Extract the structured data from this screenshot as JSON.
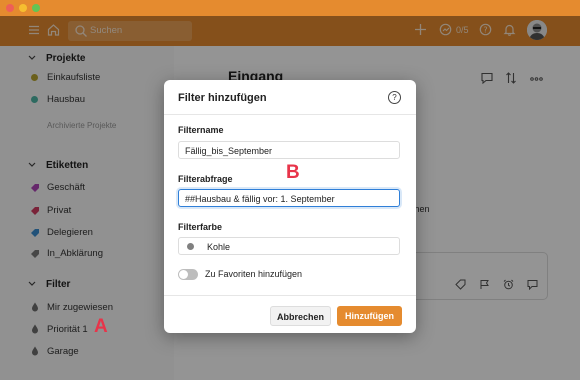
{
  "header": {
    "search_placeholder": "Suchen",
    "karma_count": "0/5"
  },
  "sidebar": {
    "projects": {
      "heading": "Projekte",
      "items": [
        {
          "label": "Einkaufsliste",
          "color": "#b8a630"
        },
        {
          "label": "Hausbau",
          "color": "#4fb7a6"
        }
      ],
      "archived_label": "Archivierte Projekte"
    },
    "labels": {
      "heading": "Etiketten",
      "items": [
        {
          "label": "Geschäft",
          "color": "#b045b8"
        },
        {
          "label": "Privat",
          "color": "#d23d62"
        },
        {
          "label": "Delegieren",
          "color": "#3b8ed0"
        },
        {
          "label": "In_Abklärung",
          "color": "#7a7a7a"
        }
      ]
    },
    "filters": {
      "heading": "Filter",
      "items": [
        {
          "label": "Mir zugewiesen"
        },
        {
          "label": "Priorität 1"
        },
        {
          "label": "Garage"
        }
      ]
    }
  },
  "main": {
    "title": "Eingang",
    "background_text": "chen"
  },
  "dialog": {
    "title": "Filter hinzufügen",
    "name_label": "Filtername",
    "name_value": "Fällig_bis_September",
    "query_label": "Filterabfrage",
    "query_value": "##Hausbau & fällig vor: 1. September",
    "color_label": "Filterfarbe",
    "color_value": "Kohle",
    "color_hex": "#808080",
    "favorite_label": "Zu Favoriten hinzufügen",
    "favorite_on": false,
    "cancel_label": "Abbrechen",
    "submit_label": "Hinzufügen"
  },
  "markers": {
    "a": "A",
    "b": "B"
  },
  "colors": {
    "brand": "#e58b2f",
    "focus": "#2f7fd8",
    "marker": "#e8344a"
  }
}
